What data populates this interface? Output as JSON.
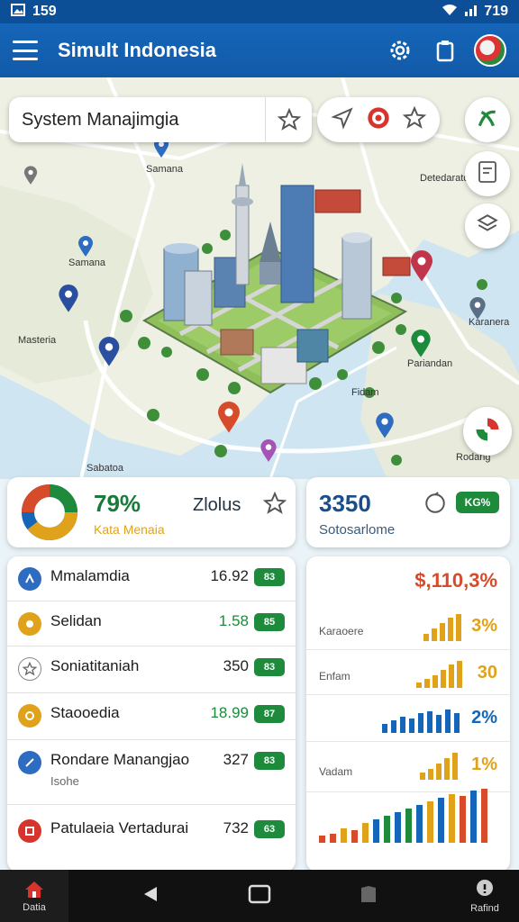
{
  "status_bar": {
    "left_text": "159",
    "right_text": "719"
  },
  "app_bar": {
    "title": "Simult Indonesia"
  },
  "map": {
    "search_text": "System Manajimgia",
    "labels": [
      "Samana",
      "Detedaraton",
      "Masteria",
      "Karanera",
      "Pariandan",
      "Sabatoa",
      "Fidam",
      "Rodang"
    ]
  },
  "stats": {
    "left": {
      "percent": "79%",
      "percent_value": 79,
      "subtitle": "Kata Menaia",
      "mid_text": "Zlolus"
    },
    "right": {
      "value": "3350",
      "subtitle": "Sotosarlome",
      "chip": "KG%"
    }
  },
  "list": [
    {
      "label": "Mmalamdia",
      "value": "16.92",
      "badge": "83"
    },
    {
      "label": "Selidan",
      "value": "1.58",
      "badge": "85"
    },
    {
      "label": "Soniatitaniah",
      "value": "350",
      "badge": "83"
    },
    {
      "label": "Staooedia",
      "value": "18.99",
      "badge": "87"
    },
    {
      "label": "Rondare Manangjao",
      "sub": "Isohe",
      "value": "327",
      "badge": "83"
    },
    {
      "label": "Patulaeia Vertadurai",
      "value": "732",
      "badge": "63"
    }
  ],
  "chart": {
    "headline": "$,110,3%",
    "rows": [
      {
        "label": "Karaoere",
        "value": "3%",
        "color": "#e0a21a"
      },
      {
        "label": "Enfam",
        "value": "30",
        "color": "#e0a21a"
      },
      {
        "label": "",
        "value": "2%",
        "color": "#1565b8"
      },
      {
        "label": "Vadam",
        "value": "1%",
        "color": "#e0a21a"
      }
    ]
  },
  "nav": {
    "home_label": "Datia",
    "right_label": "Rafind"
  },
  "colors": {
    "primary": "#1565b8",
    "green": "#1e8a3c",
    "amber": "#e0a21a",
    "red": "#d64b2a"
  }
}
